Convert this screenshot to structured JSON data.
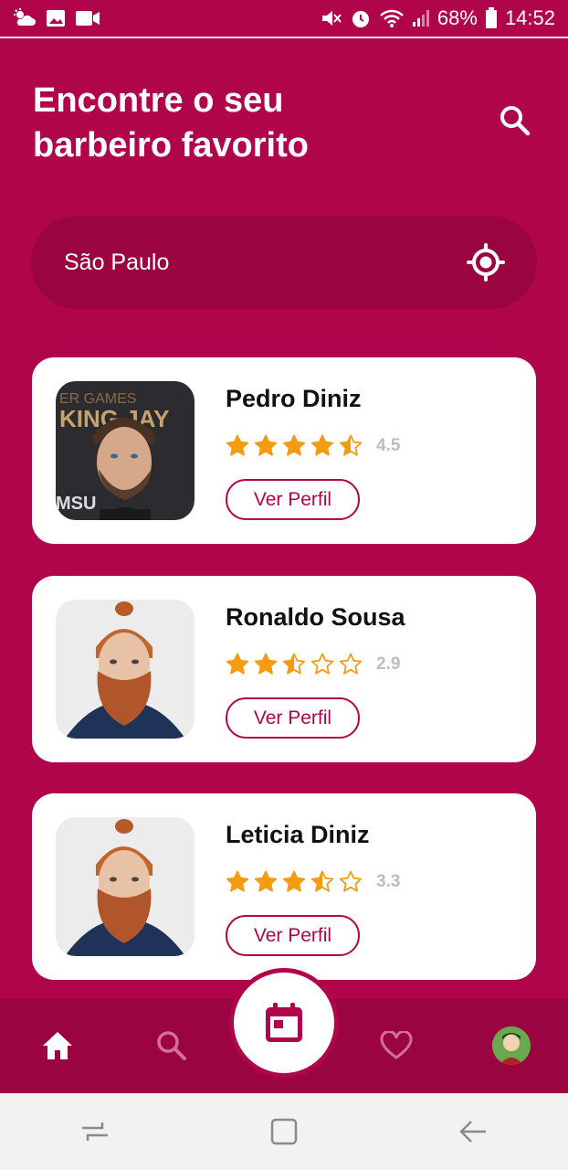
{
  "status_bar": {
    "battery": "68%",
    "time": "14:52"
  },
  "header": {
    "title_line1": "Encontre o seu",
    "title_line2": "barbeiro favorito"
  },
  "location": {
    "value": "São Paulo"
  },
  "barbers": [
    {
      "name": "Pedro Diniz",
      "rating": "4.5",
      "stars": 4.5,
      "button_label": "Ver Perfil"
    },
    {
      "name": "Ronaldo Sousa",
      "rating": "2.9",
      "stars": 2.5,
      "button_label": "Ver Perfil"
    },
    {
      "name": "Leticia Diniz",
      "rating": "3.3",
      "stars": 3.5,
      "button_label": "Ver Perfil"
    }
  ],
  "colors": {
    "brand": "#b1054b",
    "brand_dark": "#9a0440",
    "star": "#f39c12"
  },
  "bottom_nav": {
    "items": [
      "home-icon",
      "search-icon",
      "calendar-icon",
      "heart-icon",
      "avatar"
    ]
  }
}
